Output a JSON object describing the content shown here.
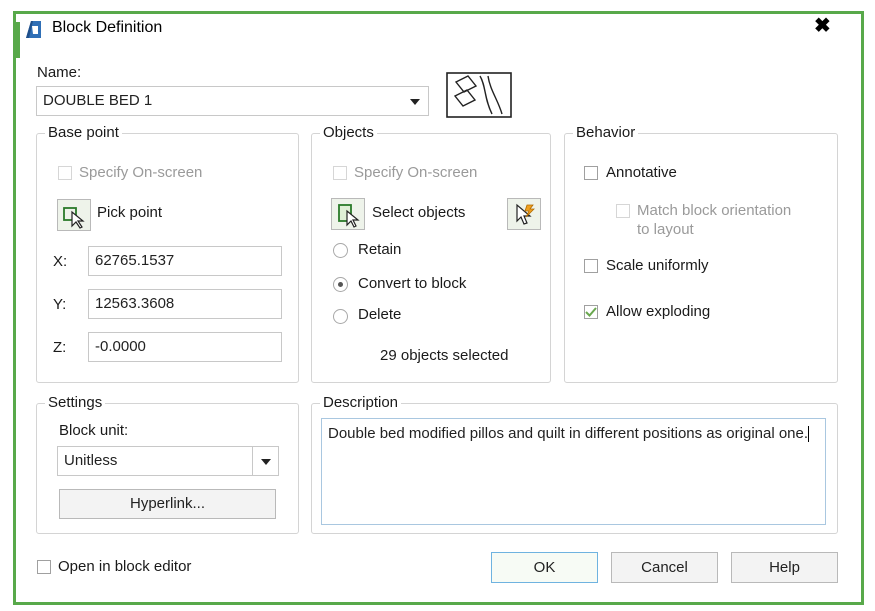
{
  "window": {
    "title": "Block Definition",
    "close_symbol": "✖",
    "accent": "#58a94a"
  },
  "name": {
    "label": "Name:",
    "value": "DOUBLE BED 1"
  },
  "base_point": {
    "legend": "Base point",
    "specify_on_screen": "Specify On-screen",
    "pick_point": "Pick point",
    "x_label": "X:",
    "x_value": "62765.1537",
    "y_label": "Y:",
    "y_value": "12563.3608",
    "z_label": "Z:",
    "z_value": "-0.0000"
  },
  "objects": {
    "legend": "Objects",
    "specify_on_screen": "Specify On-screen",
    "select_objects": "Select objects",
    "retain": "Retain",
    "convert_to_block": "Convert to block",
    "delete": "Delete",
    "selected_count": "29 objects selected"
  },
  "behavior": {
    "legend": "Behavior",
    "annotative": "Annotative",
    "match_orientation_line1": "Match block orientation",
    "match_orientation_line2": "to layout",
    "scale_uniformly": "Scale uniformly",
    "allow_exploding": "Allow exploding"
  },
  "settings": {
    "legend": "Settings",
    "block_unit_label": "Block unit:",
    "block_unit_value": "Unitless",
    "hyperlink": "Hyperlink..."
  },
  "description": {
    "legend": "Description",
    "text": "Double bed modified pillos and quilt in different positions as original one."
  },
  "footer": {
    "open_in_editor": "Open in block editor",
    "ok": "OK",
    "cancel": "Cancel",
    "help": "Help"
  }
}
